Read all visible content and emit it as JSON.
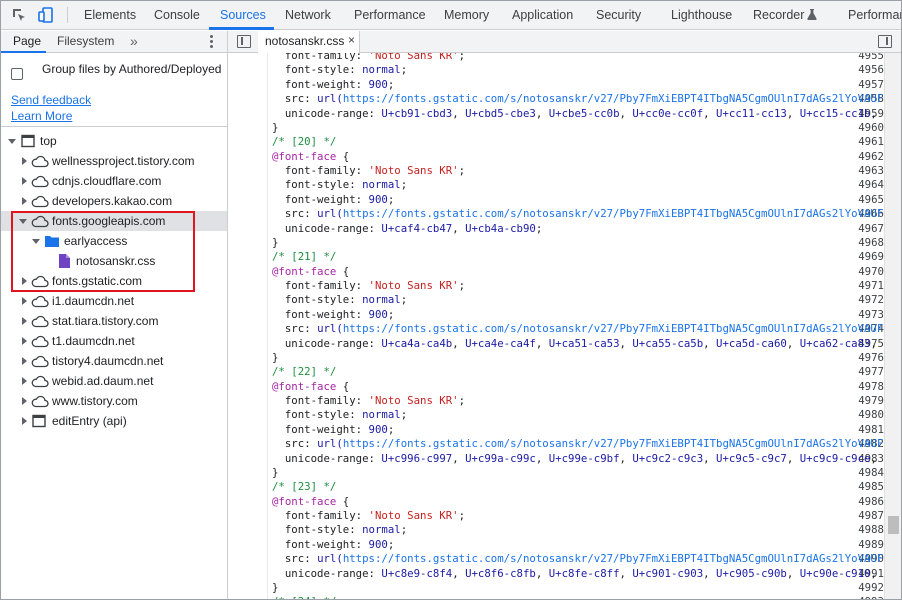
{
  "toolbar": {
    "tabs": [
      {
        "label": "Elements",
        "active": false
      },
      {
        "label": "Console",
        "active": false
      },
      {
        "label": "Sources",
        "active": true
      },
      {
        "label": "Network",
        "active": false
      },
      {
        "label": "Performance",
        "active": false
      },
      {
        "label": "Memory",
        "active": false
      },
      {
        "label": "Application",
        "active": false
      },
      {
        "label": "Security",
        "active": false
      },
      {
        "label": "Lighthouse",
        "active": false
      },
      {
        "label": "Recorder",
        "active": false
      },
      {
        "label": "Performan",
        "active": false
      }
    ],
    "icons": [
      "inspect-element-icon",
      "device-toolbar-icon",
      "flask-icon"
    ]
  },
  "navigator": {
    "tabs": [
      "Page",
      "Filesystem"
    ],
    "more": "»",
    "group_label": "Group files by Authored/Deployed",
    "group_checked": false,
    "send_feedback": "Send feedback",
    "learn_more": "Learn More",
    "tree": [
      {
        "label": "top",
        "type": "frame",
        "expanded": true
      },
      {
        "label": "wellnessproject.tistory.com",
        "type": "domain",
        "expanded": false
      },
      {
        "label": "cdnjs.cloudflare.com",
        "type": "domain",
        "expanded": false
      },
      {
        "label": "developers.kakao.com",
        "type": "domain",
        "expanded": false
      },
      {
        "label": "fonts.googleapis.com",
        "type": "domain",
        "expanded": true,
        "selected": true
      },
      {
        "label": "earlyaccess",
        "type": "folder",
        "expanded": true
      },
      {
        "label": "notosanskr.css",
        "type": "file"
      },
      {
        "label": "fonts.gstatic.com",
        "type": "domain",
        "expanded": false
      },
      {
        "label": "i1.daumcdn.net",
        "type": "domain",
        "expanded": false
      },
      {
        "label": "stat.tiara.tistory.com",
        "type": "domain",
        "expanded": false
      },
      {
        "label": "t1.daumcdn.net",
        "type": "domain",
        "expanded": false
      },
      {
        "label": "tistory4.daumcdn.net",
        "type": "domain",
        "expanded": false
      },
      {
        "label": "webid.ad.daum.net",
        "type": "domain",
        "expanded": false
      },
      {
        "label": "www.tistory.com",
        "type": "domain",
        "expanded": false
      },
      {
        "label": "editEntry (api)",
        "type": "frame",
        "expanded": false
      }
    ]
  },
  "editor": {
    "file_tab": "notosanskr.css",
    "close_symbol": "×",
    "lines": [
      {
        "n": "4955",
        "text": "  font-family: 'Noto Sans KR';"
      },
      {
        "n": "4956",
        "text": "  font-style: normal;"
      },
      {
        "n": "4957",
        "text": "  font-weight: 900;"
      },
      {
        "n": "4958",
        "text": "  src: url(https://fonts.gstatic.com/s/notosanskr/v27/Pby7FmXiEBPT4ITbgNA5CgmOUlnI7dAGs2lYoVAUF9"
      },
      {
        "n": "4959",
        "text": "  unicode-range: U+cb91-cbd3, U+cbd5-cbe3, U+cbe5-cc0b, U+cc0e-cc0f, U+cc11-cc13, U+cc15-cc1b,"
      },
      {
        "n": "4960",
        "text": "}"
      },
      {
        "n": "4961",
        "text": "/* [20] */"
      },
      {
        "n": "4962",
        "text": "@font-face {"
      },
      {
        "n": "4963",
        "text": "  font-family: 'Noto Sans KR';"
      },
      {
        "n": "4964",
        "text": "  font-style: normal;"
      },
      {
        "n": "4965",
        "text": "  font-weight: 900;"
      },
      {
        "n": "4966",
        "text": "  src: url(https://fonts.gstatic.com/s/notosanskr/v27/Pby7FmXiEBPT4ITbgNA5CgmOUlnI7dAGs2lYoVAUF9"
      },
      {
        "n": "4967",
        "text": "  unicode-range: U+caf4-cb47, U+cb4a-cb90;"
      },
      {
        "n": "4968",
        "text": "}"
      },
      {
        "n": "4969",
        "text": "/* [21] */"
      },
      {
        "n": "4970",
        "text": "@font-face {"
      },
      {
        "n": "4971",
        "text": "  font-family: 'Noto Sans KR';"
      },
      {
        "n": "4972",
        "text": "  font-style: normal;"
      },
      {
        "n": "4973",
        "text": "  font-weight: 900;"
      },
      {
        "n": "4974",
        "text": "  src: url(https://fonts.gstatic.com/s/notosanskr/v27/Pby7FmXiEBPT4ITbgNA5CgmOUlnI7dAGs2lYoVAUF9"
      },
      {
        "n": "4975",
        "text": "  unicode-range: U+ca4a-ca4b, U+ca4e-ca4f, U+ca51-ca53, U+ca55-ca5b, U+ca5d-ca60, U+ca62-ca83,"
      },
      {
        "n": "4976",
        "text": "}"
      },
      {
        "n": "4977",
        "text": "/* [22] */"
      },
      {
        "n": "4978",
        "text": "@font-face {"
      },
      {
        "n": "4979",
        "text": "  font-family: 'Noto Sans KR';"
      },
      {
        "n": "4980",
        "text": "  font-style: normal;"
      },
      {
        "n": "4981",
        "text": "  font-weight: 900;"
      },
      {
        "n": "4982",
        "text": "  src: url(https://fonts.gstatic.com/s/notosanskr/v27/Pby7FmXiEBPT4ITbgNA5CgmOUlnI7dAGs2lYoVAUF9"
      },
      {
        "n": "4983",
        "text": "  unicode-range: U+c996-c997, U+c99a-c99c, U+c99e-c9bf, U+c9c2-c9c3, U+c9c5-c9c7, U+c9c9-c9ce,"
      },
      {
        "n": "4984",
        "text": "}"
      },
      {
        "n": "4985",
        "text": "/* [23] */"
      },
      {
        "n": "4986",
        "text": "@font-face {"
      },
      {
        "n": "4987",
        "text": "  font-family: 'Noto Sans KR';"
      },
      {
        "n": "4988",
        "text": "  font-style: normal;"
      },
      {
        "n": "4989",
        "text": "  font-weight: 900;"
      },
      {
        "n": "4990",
        "text": "  src: url(https://fonts.gstatic.com/s/notosanskr/v27/Pby7FmXiEBPT4ITbgNA5CgmOUlnI7dAGs2lYoVAUF9"
      },
      {
        "n": "4991",
        "text": "  unicode-range: U+c8e9-c8f4, U+c8f6-c8fb, U+c8fe-c8ff, U+c901-c903, U+c905-c90b, U+c90e-c910,"
      },
      {
        "n": "4992",
        "text": "}"
      },
      {
        "n": "4993",
        "text": "/* [24] */"
      }
    ]
  },
  "colors": {
    "accent": "#1a73e8",
    "highlight_box": "#e0161e",
    "comment": "#1e8e3e",
    "at_rule": "#a626a4",
    "string": "#c5221f",
    "number": "#1a1aa6"
  }
}
